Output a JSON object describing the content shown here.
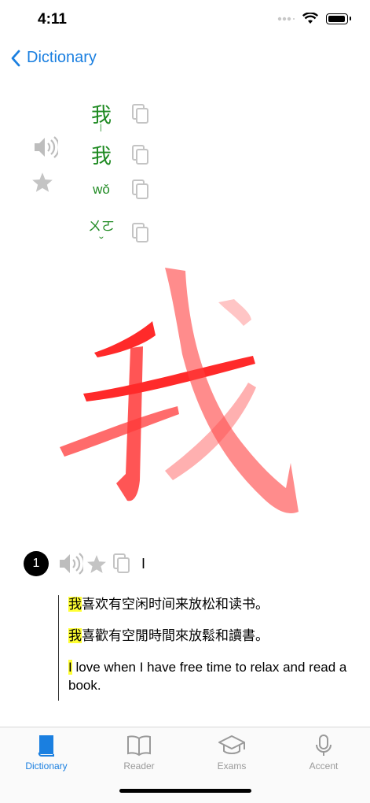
{
  "status_bar": {
    "time": "4:11"
  },
  "nav": {
    "back_label": "Dictionary"
  },
  "entry": {
    "simplified": "我",
    "separator": "|",
    "traditional": "我",
    "pinyin": "wǒ",
    "zhuyin": "ㄨㄛˇ"
  },
  "definition": {
    "number": "1",
    "meaning": "I"
  },
  "examples": {
    "simplified_highlight": "我",
    "simplified_rest": "喜欢有空闲时间来放松和读书。",
    "traditional_highlight": "我",
    "traditional_rest": "喜歡有空閒時間來放鬆和讀書。",
    "english_highlight": "I",
    "english_rest": " love when I have free time to relax and read a book."
  },
  "tabs": [
    {
      "label": "Dictionary",
      "icon": "book-icon",
      "active": true
    },
    {
      "label": "Reader",
      "icon": "open-book-icon",
      "active": false
    },
    {
      "label": "Exams",
      "icon": "graduation-cap-icon",
      "active": false
    },
    {
      "label": "Accent",
      "icon": "microphone-icon",
      "active": false
    }
  ],
  "colors": {
    "accent": "#1a7fe0",
    "character_green": "#1f8a22",
    "stroke_red": "#ff2a2a",
    "highlight": "#ffff33"
  }
}
